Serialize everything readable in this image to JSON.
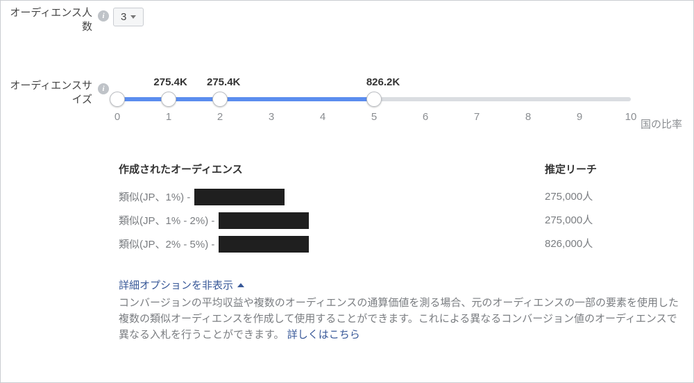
{
  "labels": {
    "audienceCount": "オーディエンス人数",
    "audienceSize": "オーディエンスサイズ",
    "axis": "国の比率"
  },
  "dropdown": {
    "value": "3"
  },
  "slider": {
    "min": 0,
    "max": 10,
    "fillStart": 0,
    "fillEnd": 5,
    "handles": [
      0,
      1,
      2,
      5
    ],
    "valueLabels": [
      {
        "pos": 1,
        "text": "275.4K"
      },
      {
        "pos": 2,
        "text": "275.4K"
      },
      {
        "pos": 5,
        "text": "826.2K"
      }
    ],
    "ticks": [
      "0",
      "1",
      "2",
      "3",
      "4",
      "5",
      "6",
      "7",
      "8",
      "9",
      "10"
    ]
  },
  "audiences": {
    "createdHeader": "作成されたオーディエンス",
    "reachHeader": "推定リーチ",
    "rows": [
      {
        "label": "類似(JP、1%) -",
        "redactWidth": 130,
        "reach": "275,000人"
      },
      {
        "label": "類似(JP、1% - 2%) -",
        "redactWidth": 130,
        "reach": "275,000人"
      },
      {
        "label": "類似(JP、2% - 5%) -",
        "redactWidth": 130,
        "reach": "826,000人"
      }
    ]
  },
  "advanced": {
    "toggle": "詳細オプションを非表示",
    "desc": "コンバージョンの平均収益や複数のオーディエンスの通算価値を測る場合、元のオーディエンスの一部の要素を使用した複数の類似オーディエンスを作成して使用することができます。これによる異なるコンバージョン値のオーディエンスで異なる入札を行うことができます。",
    "link": "詳しくはこちら"
  }
}
